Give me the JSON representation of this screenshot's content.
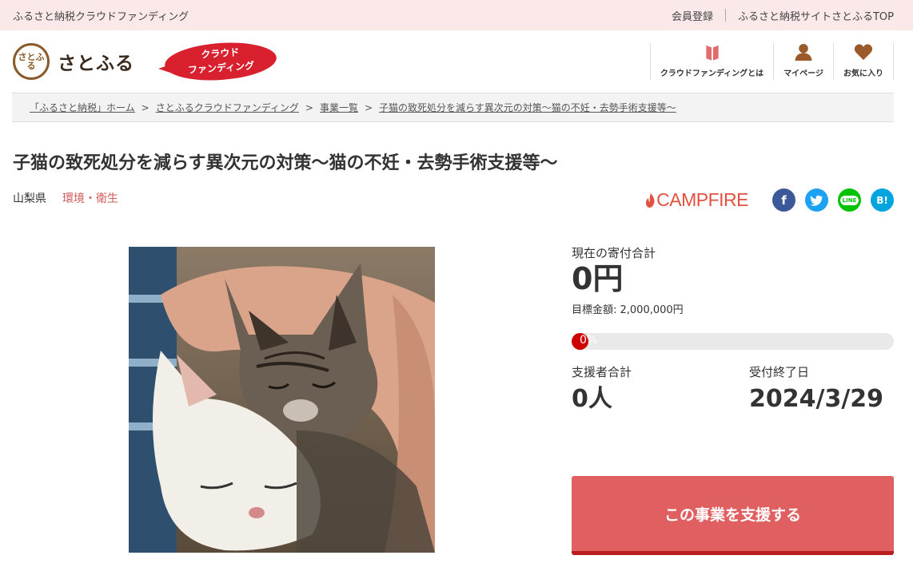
{
  "topbar": {
    "site_title": "ふるさと納税クラウドファンディング",
    "member_register": "会員登録",
    "satofull_top": "ふるさと納税サイトさとふるTOP"
  },
  "header": {
    "logo_mark": "さとふる",
    "logo_name": "さとふる",
    "badge_line1": "クラウド",
    "badge_line2": "ファンディング",
    "nav": {
      "about": "クラウドファンディングとは",
      "mypage": "マイページ",
      "favorites": "お気に入り"
    }
  },
  "breadcrumb": [
    "「ふるさと納税」ホーム",
    "さとふるクラウドファンディング",
    "事業一覧",
    "子猫の致死処分を減らす異次元の対策～猫の不妊・去勢手術支援等～"
  ],
  "project": {
    "title": "子猫の致死処分を減らす異次元の対策～猫の不妊・去勢手術支援等～",
    "prefecture": "山梨県",
    "category": "環境・衛生",
    "partner": "CAMPFIRE"
  },
  "share": {
    "facebook": "f",
    "twitter": "t",
    "line": "LINE",
    "hatena": "B!"
  },
  "stats": {
    "current_label": "現在の寄付合計",
    "current_value": "0円",
    "goal_label": "目標金額: 2,000,000円",
    "progress_label": "0%",
    "progress": 0,
    "supporters_label": "支援者合計",
    "supporters_value": "0人",
    "deadline_label": "受付終了日",
    "deadline_value": "2024/3/29"
  },
  "cta": {
    "label": "この事業を支援する"
  },
  "colors": {
    "accent": "#e05f60",
    "topbar": "#fbe9ea",
    "category": "#d35a5a"
  }
}
